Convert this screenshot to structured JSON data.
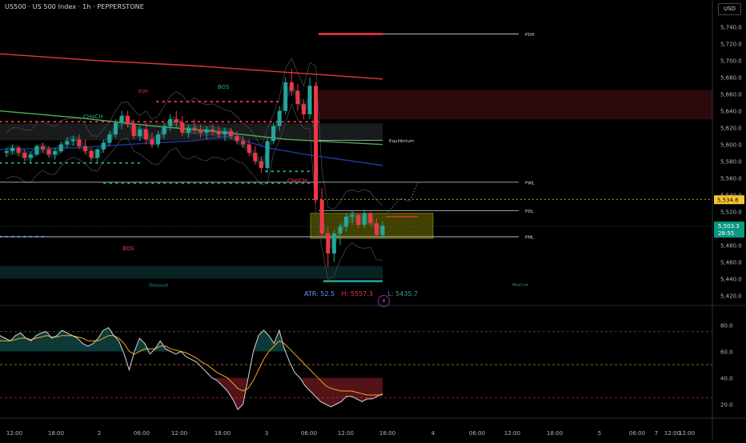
{
  "header": {
    "symbol_title": "US500 · US 500 Index · 1h · PEPPERSTONE",
    "currency_button": "USD"
  },
  "price_axis": {
    "ticks": [
      "5,740.0",
      "5,720.0",
      "5,700.0",
      "5,680.0",
      "5,660.0",
      "5,640.0",
      "5,620.0",
      "5,600.0",
      "5,580.0",
      "5,560.0",
      "5,540.0",
      "5,520.0",
      "5,480.0",
      "5,460.0",
      "5,440.0",
      "5,420.0"
    ],
    "dashed_badge": "5,534.6",
    "last_price_badge": "5,503.3",
    "countdown": "28:55"
  },
  "oscillator_axis": {
    "ticks": [
      "80.0",
      "60.0",
      "40.0",
      "20.0"
    ]
  },
  "time_axis": {
    "ticks": [
      "12:00",
      "18:00",
      "2",
      "06:00",
      "12:00",
      "18:00",
      "3",
      "06:00",
      "12:00",
      "18:00",
      "4",
      "06:00",
      "12:00",
      "18:00",
      "5",
      "06:00",
      "12:00",
      "18:00",
      "7",
      "12:00"
    ]
  },
  "level_labels": {
    "pdh": "PDH",
    "equilibrium": "Equilibrium",
    "pwl": "PWL",
    "pdl": "PDL",
    "pml": "PML",
    "discount": "Discount",
    "weak_low": "Weak Low"
  },
  "structure_labels": {
    "eqh": "EQH",
    "bos_top": "BOS",
    "choch_left": "CHoCH",
    "choch_right": "CHoCH",
    "bos_left": "BOS"
  },
  "stats": {
    "atr": "ATR: 52.5",
    "high": "H: 5557.3",
    "low": "L: 5435.7"
  },
  "flash_icon_glyph": "⚡",
  "colors": {
    "bull": "#26a69a",
    "bear": "#f23645",
    "ma_red": "#e53935",
    "ma_green": "#4caf50",
    "ma_blue": "#1e3a9e",
    "fvg_yellow": "#c6c600",
    "badge_yellow": "#f7c52f",
    "badge_green": "#089981",
    "stat_blue": "#5b9cf6",
    "stat_red": "#f23645",
    "stat_green": "#26a69a"
  },
  "chart_data": [
    {
      "type": "candlestick",
      "yrange": [
        5410,
        5755
      ],
      "candles": [
        [
          5590,
          5596,
          5585,
          5592
        ],
        [
          5592,
          5600,
          5588,
          5596
        ],
        [
          5596,
          5598,
          5586,
          5590
        ],
        [
          5590,
          5594,
          5580,
          5584
        ],
        [
          5584,
          5592,
          5578,
          5588
        ],
        [
          5588,
          5600,
          5586,
          5598
        ],
        [
          5598,
          5602,
          5590,
          5594
        ],
        [
          5594,
          5598,
          5584,
          5588
        ],
        [
          5588,
          5596,
          5582,
          5592
        ],
        [
          5592,
          5604,
          5590,
          5600
        ],
        [
          5600,
          5608,
          5596,
          5604
        ],
        [
          5604,
          5610,
          5598,
          5606
        ],
        [
          5606,
          5612,
          5594,
          5598
        ],
        [
          5598,
          5606,
          5588,
          5592
        ],
        [
          5592,
          5596,
          5580,
          5584
        ],
        [
          5584,
          5596,
          5578,
          5594
        ],
        [
          5594,
          5606,
          5590,
          5602
        ],
        [
          5602,
          5616,
          5598,
          5612
        ],
        [
          5612,
          5630,
          5608,
          5626
        ],
        [
          5626,
          5640,
          5618,
          5634
        ],
        [
          5634,
          5640,
          5620,
          5624
        ],
        [
          5624,
          5630,
          5606,
          5610
        ],
        [
          5610,
          5622,
          5604,
          5618
        ],
        [
          5618,
          5626,
          5600,
          5606
        ],
        [
          5606,
          5614,
          5596,
          5600
        ],
        [
          5600,
          5616,
          5596,
          5612
        ],
        [
          5612,
          5626,
          5606,
          5622
        ],
        [
          5622,
          5636,
          5616,
          5630
        ],
        [
          5630,
          5640,
          5620,
          5626
        ],
        [
          5626,
          5634,
          5610,
          5614
        ],
        [
          5614,
          5624,
          5608,
          5620
        ],
        [
          5620,
          5630,
          5612,
          5618
        ],
        [
          5618,
          5624,
          5608,
          5614
        ],
        [
          5614,
          5622,
          5606,
          5618
        ],
        [
          5618,
          5624,
          5610,
          5616
        ],
        [
          5616,
          5622,
          5608,
          5612
        ],
        [
          5612,
          5620,
          5604,
          5616
        ],
        [
          5616,
          5620,
          5606,
          5610
        ],
        [
          5610,
          5616,
          5600,
          5604
        ],
        [
          5604,
          5610,
          5596,
          5600
        ],
        [
          5600,
          5606,
          5586,
          5590
        ],
        [
          5590,
          5598,
          5576,
          5580
        ],
        [
          5580,
          5586,
          5566,
          5572
        ],
        [
          5572,
          5608,
          5566,
          5604
        ],
        [
          5604,
          5626,
          5600,
          5622
        ],
        [
          5622,
          5646,
          5616,
          5640
        ],
        [
          5640,
          5680,
          5636,
          5674
        ],
        [
          5674,
          5690,
          5658,
          5664
        ],
        [
          5664,
          5672,
          5640,
          5648
        ],
        [
          5648,
          5654,
          5630,
          5636
        ],
        [
          5636,
          5680,
          5630,
          5670
        ],
        [
          5670,
          5674,
          5530,
          5534
        ],
        [
          5534,
          5548,
          5490,
          5494
        ],
        [
          5494,
          5502,
          5454,
          5470
        ],
        [
          5470,
          5498,
          5460,
          5494
        ],
        [
          5494,
          5506,
          5480,
          5502
        ],
        [
          5502,
          5518,
          5496,
          5514
        ],
        [
          5514,
          5520,
          5504,
          5516
        ],
        [
          5516,
          5518,
          5500,
          5504
        ],
        [
          5504,
          5522,
          5500,
          5518
        ],
        [
          5518,
          5520,
          5502,
          5506
        ],
        [
          5506,
          5512,
          5488,
          5492
        ],
        [
          5492,
          5508,
          5488,
          5503
        ]
      ],
      "moving_averages": [
        {
          "color": "#e53935",
          "values": [
            [
              0,
              5708
            ],
            [
              25,
              5700
            ],
            [
              50,
              5694
            ],
            [
              75,
              5686
            ],
            [
              100,
              5678
            ]
          ]
        },
        {
          "color": "#4caf50",
          "values": [
            [
              0,
              5640
            ],
            [
              20,
              5632
            ],
            [
              40,
              5622
            ],
            [
              55,
              5616
            ],
            [
              75,
              5606
            ],
            [
              100,
              5600
            ]
          ]
        },
        {
          "color": "#1e3a9e",
          "values": [
            [
              0,
              5594
            ],
            [
              20,
              5596
            ],
            [
              40,
              5602
            ],
            [
              50,
              5604
            ],
            [
              60,
              5610
            ],
            [
              70,
              5596
            ],
            [
              80,
              5588
            ],
            [
              100,
              5575
            ]
          ]
        }
      ],
      "horizontal_levels": [
        {
          "name": "PDH",
          "price": 5731.6
        },
        {
          "name": "Equilibrium",
          "price": 5605
        },
        {
          "name": "PWL",
          "price": 5555
        },
        {
          "name": "PDL",
          "price": 5521
        },
        {
          "name": "PML",
          "price": 5490
        },
        {
          "name": "Weak Low",
          "price": 5437
        }
      ],
      "zones": [
        {
          "kind": "premium",
          "color": "#f23645",
          "from": 5630,
          "to": 5665
        },
        {
          "kind": "equilibrium",
          "color": "#787b86",
          "from": 5605,
          "to": 5625
        },
        {
          "kind": "discount",
          "color": "#26a69a",
          "from": 5440,
          "to": 5455
        },
        {
          "kind": "fvg",
          "color": "#c6c600",
          "from": 5488,
          "to": 5518
        }
      ],
      "price_ticks": [
        5740,
        5720,
        5700,
        5680,
        5660,
        5640,
        5620,
        5600,
        5580,
        5560,
        5540,
        5520,
        5480,
        5460,
        5440,
        5420
      ],
      "last_price": 5503.3,
      "dashed_price": 5534.6
    },
    {
      "type": "line",
      "yrange": [
        10,
        90
      ],
      "ticks": [
        80,
        60,
        40,
        20
      ],
      "levels": [
        75,
        50,
        25
      ],
      "series": [
        {
          "color": "#d1d4dc",
          "values": [
            72,
            70,
            68,
            72,
            74,
            70,
            68,
            72,
            74,
            75,
            70,
            72,
            76,
            74,
            72,
            70,
            66,
            64,
            66,
            70,
            76,
            78,
            72,
            68,
            58,
            46,
            60,
            70,
            66,
            58,
            62,
            68,
            62,
            60,
            58,
            60,
            56,
            54,
            52,
            48,
            44,
            40,
            38,
            34,
            30,
            24,
            16,
            20,
            40,
            60,
            72,
            76,
            72,
            66,
            76,
            62,
            52,
            44,
            40,
            34,
            30,
            26,
            22,
            20,
            18,
            20,
            22,
            26,
            26,
            24,
            22,
            24,
            24,
            26,
            28
          ]
        },
        {
          "color": "#f5a623",
          "values": [
            68,
            68,
            68,
            69,
            70,
            70,
            69,
            70,
            71,
            72,
            71,
            71,
            72,
            72,
            72,
            71,
            70,
            68,
            68,
            68,
            70,
            72,
            72,
            70,
            66,
            60,
            58,
            60,
            62,
            62,
            62,
            64,
            64,
            62,
            61,
            60,
            59,
            57,
            55,
            52,
            50,
            47,
            44,
            42,
            40,
            36,
            32,
            30,
            32,
            38,
            46,
            54,
            60,
            64,
            68,
            66,
            62,
            58,
            54,
            50,
            46,
            42,
            38,
            34,
            32,
            31,
            30,
            30,
            30,
            29,
            28,
            27,
            27,
            27,
            27
          ]
        }
      ]
    }
  ]
}
